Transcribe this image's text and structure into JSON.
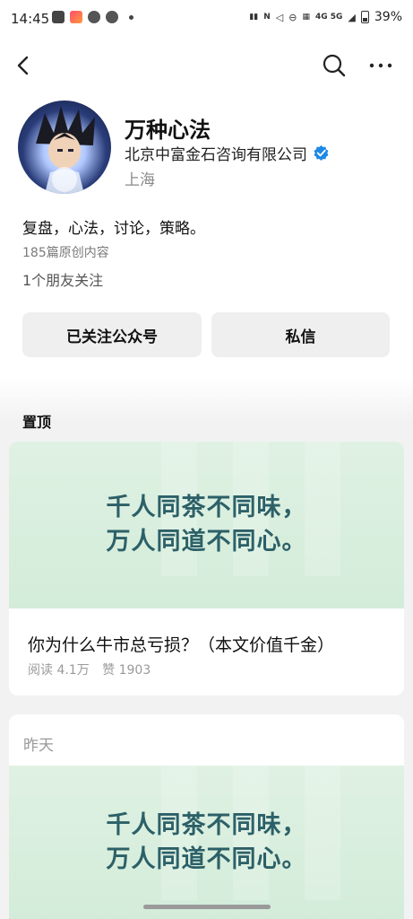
{
  "status_bar": {
    "time": "14:45",
    "battery_text": "39%",
    "network_label": "4G 5G"
  },
  "nav": {
    "back_icon": "chevron-left-icon",
    "search_icon": "search-icon",
    "more_icon": "more-horizontal-icon"
  },
  "profile": {
    "name": "万种心法",
    "company": "北京中富金石咨询有限公司",
    "location": "上海",
    "bio": "复盘，心法，讨论，策略。",
    "article_count": "185篇原创内容",
    "friends_follow": "1个朋友关注",
    "verified_color": "#1e88e5"
  },
  "actions": {
    "follow_label": "已关注公众号",
    "message_label": "私信"
  },
  "pinned": {
    "section_label": "置顶",
    "cover_lines": [
      "千人同茶不同味，",
      "万人同道不同心。"
    ],
    "title": "你为什么牛市总亏损？（本文价值千金）",
    "reads": "阅读 4.1万",
    "likes": "赞 1903"
  },
  "recent": {
    "date_label": "昨天",
    "cover_lines": [
      "千人同茶不同味，",
      "万人同道不同心。"
    ]
  },
  "colors": {
    "cover_bg": "#dff1e3",
    "cover_text": "#2c6068"
  }
}
